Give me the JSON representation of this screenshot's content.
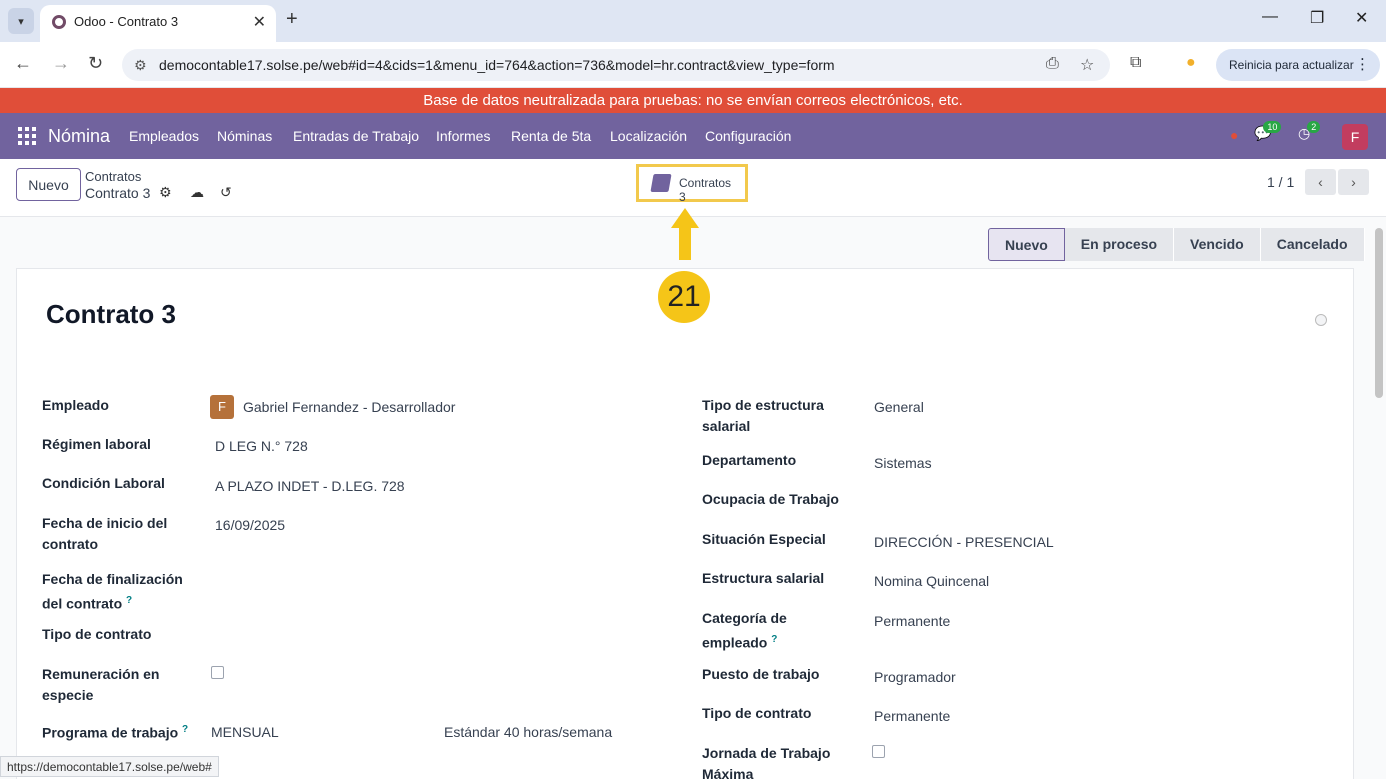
{
  "browser": {
    "tab_title": "Odoo - Contrato 3",
    "tab_close": "✕",
    "new_tab": "+",
    "url": "democontable17.solse.pe/web#id=4&cids=1&menu_id=764&action=736&model=hr.contract&view_type=form",
    "reload_label": "Reinicia para actualizar",
    "status_url": "https://democontable17.solse.pe/web#"
  },
  "banner": "Base de datos neutralizada para pruebas: no se envían correos electrónicos, etc.",
  "navbar": {
    "brand": "Nómina",
    "menu": [
      "Empleados",
      "Nóminas",
      "Entradas de Trabajo",
      "Informes",
      "Renta de 5ta",
      "Localización",
      "Configuración"
    ],
    "messages_count": "10",
    "activities_count": "2",
    "avatar_letter": "F"
  },
  "control": {
    "new_button": "Nuevo",
    "breadcrumb_parent": "Contratos",
    "breadcrumb_current": "Contrato 3",
    "smart_label": "Contratos",
    "smart_count": "3",
    "pager": "1 / 1"
  },
  "annotation_step": "21",
  "stages": [
    "Nuevo",
    "En proceso",
    "Vencido",
    "Cancelado"
  ],
  "record": {
    "title": "Contrato 3",
    "left": {
      "empleado_label": "Empleado",
      "empleado_avatar": "F",
      "empleado_value": "Gabriel Fernandez - Desarrollador",
      "regimen_label": "Régimen laboral",
      "regimen_value": "D LEG N.° 728",
      "condicion_label": "Condición Laboral",
      "condicion_value": "A PLAZO INDET - D.LEG. 728",
      "fecha_inicio_label_1": "Fecha de inicio del",
      "fecha_inicio_label_2": "contrato",
      "fecha_inicio_value": "16/09/2025",
      "fecha_fin_label_1": "Fecha de finalización",
      "fecha_fin_label_2": "del contrato",
      "tipo_contrato_label": "Tipo de contrato",
      "remuneracion_label_1": "Remuneración en",
      "remuneracion_label_2": "especie",
      "programa_label": "Programa de trabajo",
      "programa_value": "MENSUAL",
      "programa_hours": "Estándar 40 horas/semana"
    },
    "right": {
      "estructura_tipo_label_1": "Tipo de estructura",
      "estructura_tipo_label_2": "salarial",
      "estructura_tipo_value": "General",
      "departamento_label": "Departamento",
      "departamento_value": "Sistemas",
      "ocupacion_label": "Ocupacia de Trabajo",
      "situacion_label": "Situación Especial",
      "situacion_value": "DIRECCIÓN - PRESENCIAL",
      "estructura_label": "Estructura salarial",
      "estructura_value": "Nomina Quincenal",
      "categoria_label_1": "Categoría de",
      "categoria_label_2": "empleado",
      "categoria_value": "Permanente",
      "puesto_label": "Puesto de trabajo",
      "puesto_value": "Programador",
      "tipo_contrato_label": "Tipo de contrato",
      "tipo_contrato_value": "Permanente",
      "jornada_label_1": "Jornada de Trabajo",
      "jornada_label_2": "Máxima"
    },
    "help_mark": "?"
  }
}
